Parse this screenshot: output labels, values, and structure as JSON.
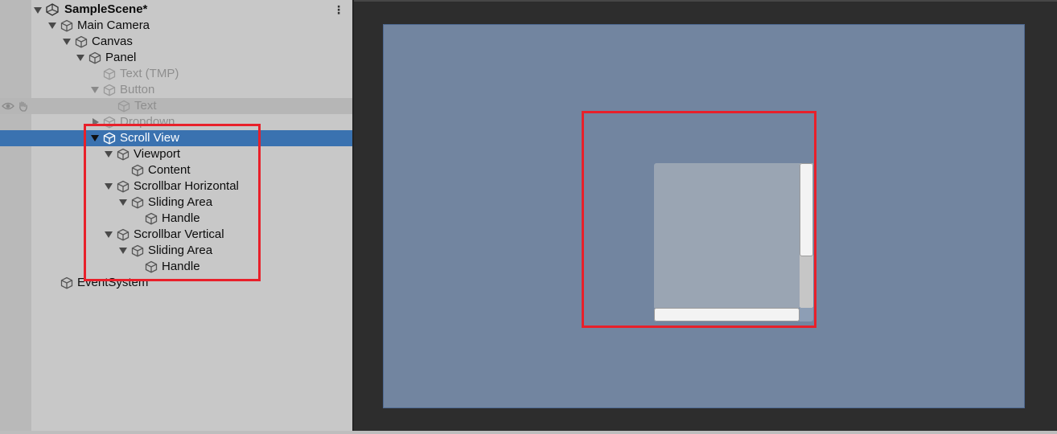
{
  "hierarchy": {
    "scene_name": "SampleScene*",
    "menu_icon": "kebab-menu-icon",
    "items": [
      {
        "label": "Main Camera",
        "state": "expanded",
        "active": true
      },
      {
        "label": "Canvas",
        "state": "expanded",
        "active": true
      },
      {
        "label": "Panel",
        "state": "expanded",
        "active": true
      },
      {
        "label": "Text (TMP)",
        "state": "leaf",
        "active": false
      },
      {
        "label": "Button",
        "state": "expanded",
        "active": false
      },
      {
        "label": "Text",
        "state": "leaf",
        "active": false
      },
      {
        "label": "Dropdown",
        "state": "collapsed",
        "active": false
      },
      {
        "label": "Scroll View",
        "state": "expanded",
        "active": true,
        "selected": true
      },
      {
        "label": "Viewport",
        "state": "expanded",
        "active": true
      },
      {
        "label": "Content",
        "state": "leaf",
        "active": true
      },
      {
        "label": "Scrollbar Horizontal",
        "state": "expanded",
        "active": true
      },
      {
        "label": "Sliding Area",
        "state": "expanded",
        "active": true
      },
      {
        "label": "Handle",
        "state": "leaf",
        "active": true
      },
      {
        "label": "Scrollbar Vertical",
        "state": "expanded",
        "active": true
      },
      {
        "label": "Sliding Area",
        "state": "expanded",
        "active": true
      },
      {
        "label": "Handle",
        "state": "leaf",
        "active": true
      },
      {
        "label": "EventSystem",
        "state": "leaf",
        "active": true
      }
    ]
  },
  "colors": {
    "selection": "#3a72b0",
    "highlight": "#e8202a",
    "canvas_panel": "#7285a0",
    "scroll_viewport": "#9aa5b3"
  }
}
